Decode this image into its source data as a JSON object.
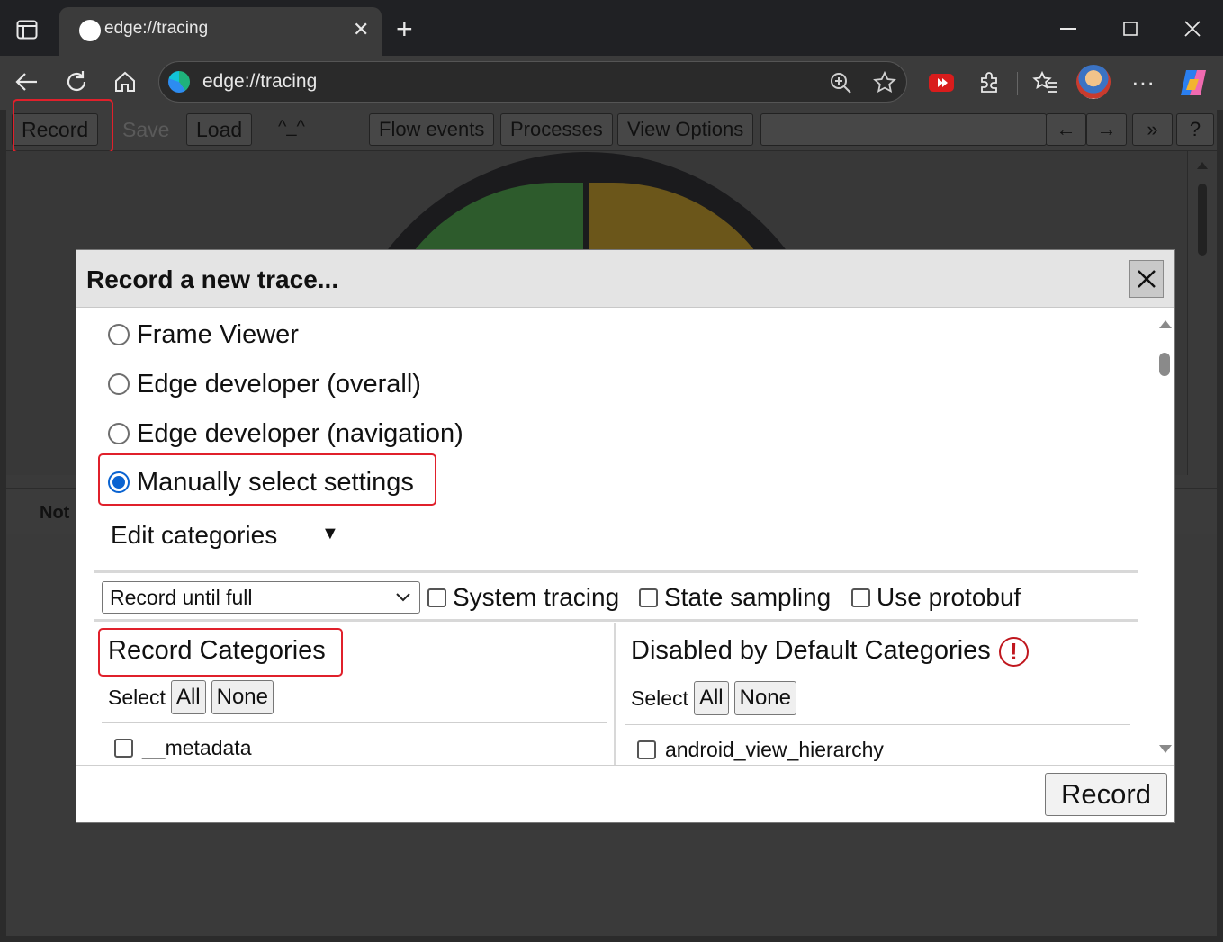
{
  "browser": {
    "tab_title": "edge://tracing",
    "tab_close": "✕",
    "new_tab": "+",
    "address": "edge://tracing",
    "window_controls": {
      "minimize": "—",
      "maximize": "☐",
      "close": "✕"
    },
    "icons": [
      "sidebar-icon",
      "back-icon",
      "refresh-icon",
      "home-icon",
      "zoom-icon",
      "favorite-star-icon",
      "extension-red-icon",
      "extensions-icon",
      "favorites-icon",
      "profile-avatar-icon",
      "more-icon",
      "copilot-icon"
    ]
  },
  "tracing_toolbar": {
    "record": "Record",
    "save": "Save",
    "load": "Load",
    "caret": "^_^",
    "flow_events": "Flow events",
    "processes": "Processes",
    "view_options": "View Options",
    "prev": "←",
    "next": "→",
    "more": "»",
    "help": "?"
  },
  "lower_panel": {
    "label": "Not"
  },
  "dialog": {
    "title": "Record a new trace...",
    "close": "✕",
    "presets": [
      {
        "label": "Frame Viewer",
        "checked": false
      },
      {
        "label": "Edge developer (overall)",
        "checked": false
      },
      {
        "label": "Edge developer (navigation)",
        "checked": false
      },
      {
        "label": "Manually select settings",
        "checked": true
      }
    ],
    "edit_categories": "Edit categories",
    "edit_arrow": "▼",
    "mode_select": "Record until full",
    "options": [
      {
        "label": "System tracing",
        "checked": false
      },
      {
        "label": "State sampling",
        "checked": false
      },
      {
        "label": "Use protobuf",
        "checked": false
      }
    ],
    "record_categories": {
      "title": "Record Categories",
      "select_label": "Select",
      "all": "All",
      "none": "None",
      "first_item": "__metadata"
    },
    "disabled_categories": {
      "title": "Disabled by Default Categories",
      "warning": "!",
      "select_label": "Select",
      "all": "All",
      "none": "None",
      "first_item": "android_view_hierarchy"
    },
    "record_button": "Record"
  },
  "colors": {
    "highlight": "#e0202b",
    "radio_accent": "#0a63d1"
  }
}
